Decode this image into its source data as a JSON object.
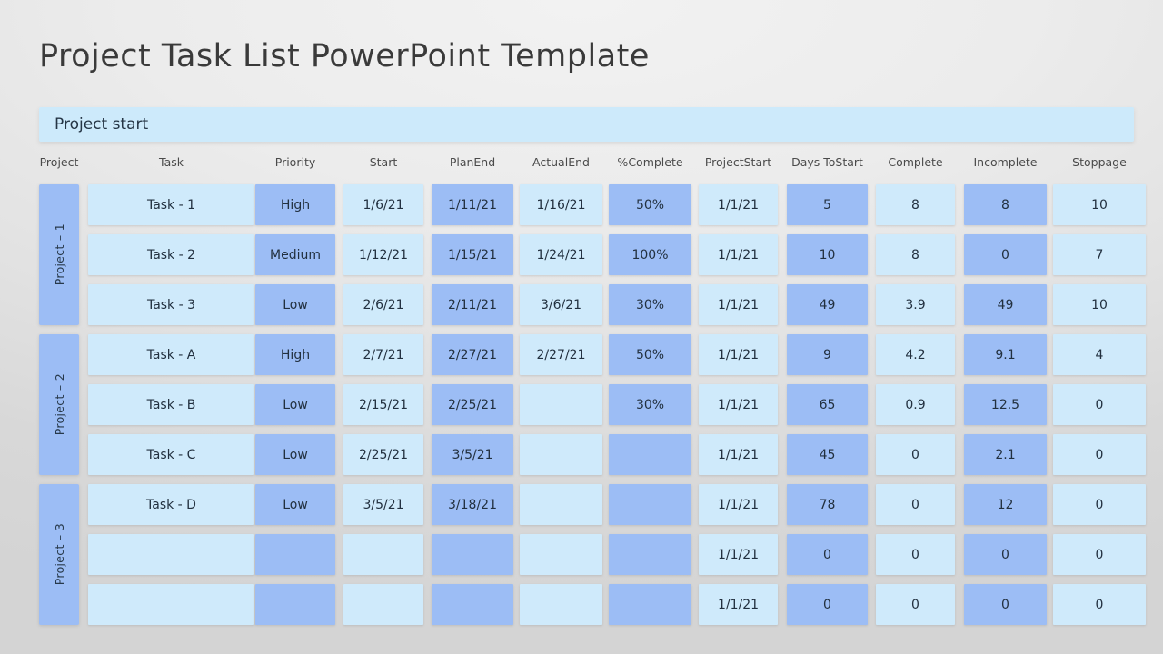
{
  "slide": {
    "title": "Project Task List PowerPoint Template",
    "banner_label": "Project start",
    "accent_light": "#cfeafb",
    "accent_dark": "#9cbdf5",
    "banner_color": "#cdeafb",
    "background": "#dcdcdc"
  },
  "table": {
    "headers": [
      "Project",
      "Task",
      "Priority",
      "Start",
      "Plan\nEnd",
      "Actual\nEnd",
      "%\nComplete",
      "Project\nStart",
      "Days To\nStart",
      "Complete",
      "Incomplete",
      "Stoppage"
    ],
    "header_lines": [
      [
        "Project"
      ],
      [
        "Task"
      ],
      [
        "Priority"
      ],
      [
        "Start"
      ],
      [
        "Plan",
        "End"
      ],
      [
        "Actual",
        "End"
      ],
      [
        "%",
        "Complete"
      ],
      [
        "Project",
        "Start"
      ],
      [
        "Days To",
        "Start"
      ],
      [
        "Complete"
      ],
      [
        "Incomplete"
      ],
      [
        "Stoppage"
      ]
    ],
    "groups": [
      {
        "label": "Project – 1",
        "rows": 3
      },
      {
        "label": "Project – 2",
        "rows": 3
      },
      {
        "label": "Project – 3",
        "rows": 3
      }
    ],
    "rows": [
      {
        "task": "Task - 1",
        "priority": "High",
        "start": "1/6/21",
        "plan_end": "1/11/21",
        "actual_end": "1/16/21",
        "pct_complete": "50%",
        "project_start": "1/1/21",
        "days_to_start": "5",
        "complete": "8",
        "incomplete": "8",
        "stoppage": "10"
      },
      {
        "task": "Task - 2",
        "priority": "Medium",
        "start": "1/12/21",
        "plan_end": "1/15/21",
        "actual_end": "1/24/21",
        "pct_complete": "100%",
        "project_start": "1/1/21",
        "days_to_start": "10",
        "complete": "8",
        "incomplete": "0",
        "stoppage": "7"
      },
      {
        "task": "Task - 3",
        "priority": "Low",
        "start": "2/6/21",
        "plan_end": "2/11/21",
        "actual_end": "3/6/21",
        "pct_complete": "30%",
        "project_start": "1/1/21",
        "days_to_start": "49",
        "complete": "3.9",
        "incomplete": "49",
        "stoppage": "10"
      },
      {
        "task": "Task - A",
        "priority": "High",
        "start": "2/7/21",
        "plan_end": "2/27/21",
        "actual_end": "2/27/21",
        "pct_complete": "50%",
        "project_start": "1/1/21",
        "days_to_start": "9",
        "complete": "4.2",
        "incomplete": "9.1",
        "stoppage": "4"
      },
      {
        "task": "Task - B",
        "priority": "Low",
        "start": "2/15/21",
        "plan_end": "2/25/21",
        "actual_end": "",
        "pct_complete": "30%",
        "project_start": "1/1/21",
        "days_to_start": "65",
        "complete": "0.9",
        "incomplete": "12.5",
        "stoppage": "0"
      },
      {
        "task": "Task - C",
        "priority": "Low",
        "start": "2/25/21",
        "plan_end": "3/5/21",
        "actual_end": "",
        "pct_complete": "",
        "project_start": "1/1/21",
        "days_to_start": "45",
        "complete": "0",
        "incomplete": "2.1",
        "stoppage": "0"
      },
      {
        "task": "Task - D",
        "priority": "Low",
        "start": "3/5/21",
        "plan_end": "3/18/21",
        "actual_end": "",
        "pct_complete": "",
        "project_start": "1/1/21",
        "days_to_start": "78",
        "complete": "0",
        "incomplete": "12",
        "stoppage": "0"
      },
      {
        "task": "",
        "priority": "",
        "start": "",
        "plan_end": "",
        "actual_end": "",
        "pct_complete": "",
        "project_start": "1/1/21",
        "days_to_start": "0",
        "complete": "0",
        "incomplete": "0",
        "stoppage": "0"
      },
      {
        "task": "",
        "priority": "",
        "start": "",
        "plan_end": "",
        "actual_end": "",
        "pct_complete": "",
        "project_start": "1/1/21",
        "days_to_start": "0",
        "complete": "0",
        "incomplete": "0",
        "stoppage": "0"
      }
    ]
  }
}
